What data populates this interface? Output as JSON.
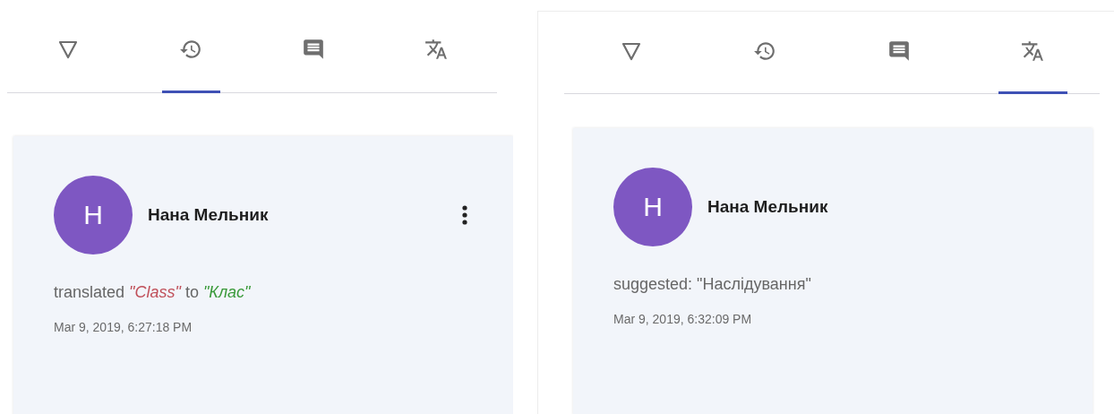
{
  "panels": [
    {
      "tabs": [
        {
          "kind": "filter",
          "selected": false
        },
        {
          "kind": "history",
          "selected": true
        },
        {
          "kind": "comments",
          "selected": false
        },
        {
          "kind": "translate",
          "selected": false
        }
      ],
      "card": {
        "avatar": "H",
        "name": "Нана Мельник",
        "menu": true,
        "activity": [
          {
            "kind": "plain",
            "text": "translated"
          },
          {
            "kind": "source",
            "text": "\"Class\""
          },
          {
            "kind": "plain",
            "text": "to"
          },
          {
            "kind": "target",
            "text": "\"Клас\""
          }
        ],
        "time": "Mar 9, 2019, 6:27:18 PM"
      }
    },
    {
      "tabs": [
        {
          "kind": "filter",
          "selected": false
        },
        {
          "kind": "history",
          "selected": false
        },
        {
          "kind": "comments",
          "selected": false
        },
        {
          "kind": "translate",
          "selected": true
        }
      ],
      "card": {
        "avatar": "H",
        "name": "Нана Мельник",
        "menu": false,
        "activity": [
          {
            "kind": "plain",
            "text": "suggested: \"Наслідування\""
          }
        ],
        "time": "Mar 9, 2019, 6:32:09 PM"
      }
    }
  ]
}
